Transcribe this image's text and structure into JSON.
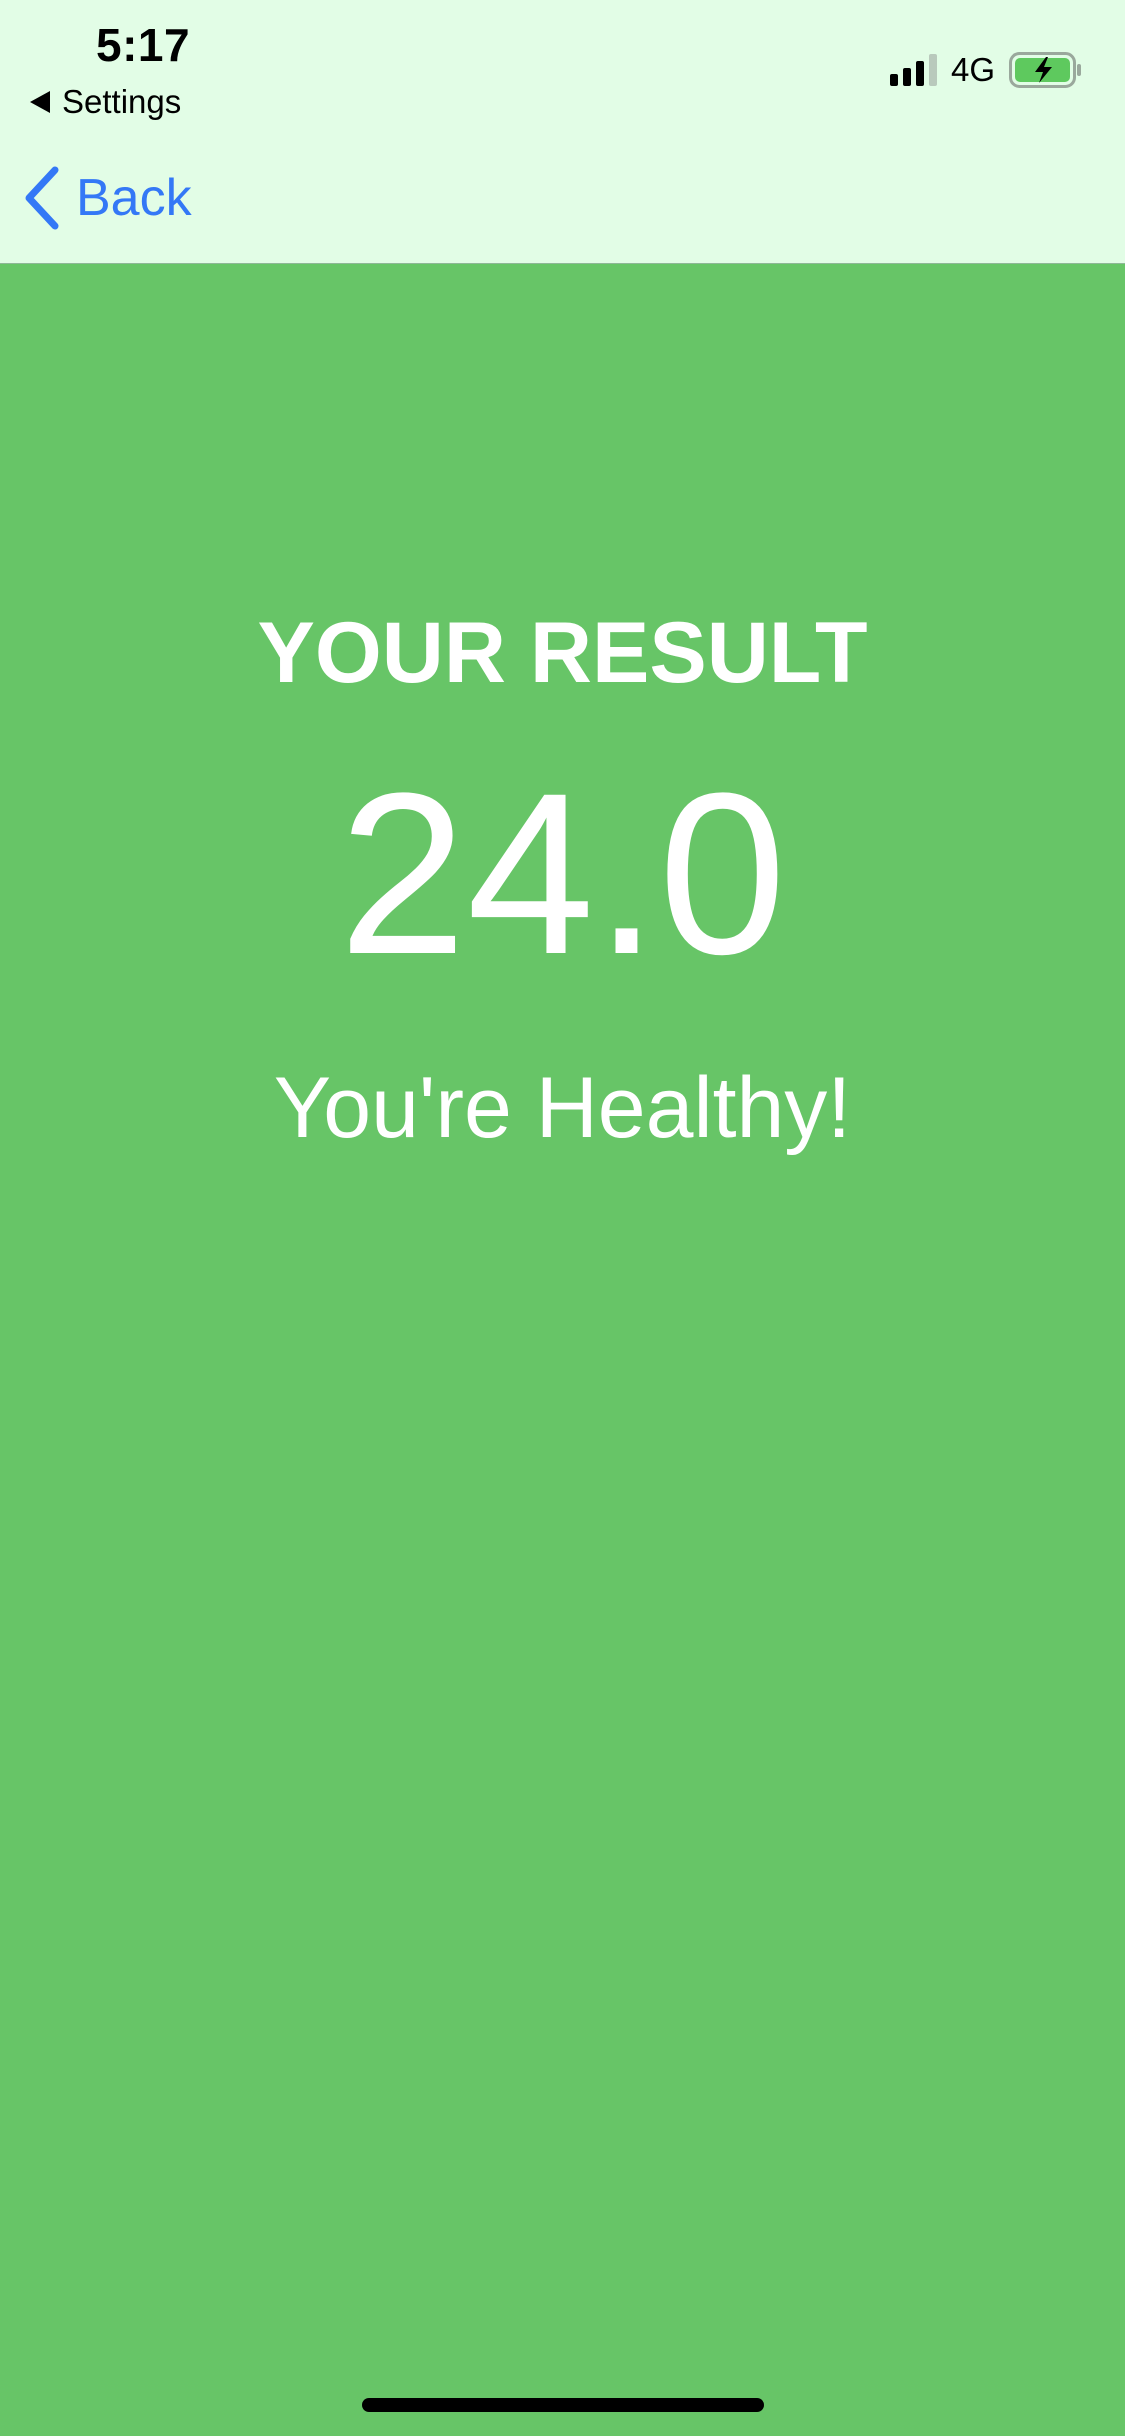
{
  "status_bar": {
    "time": "5:17",
    "back_to_app_label": "Settings",
    "network": "4G",
    "signal_bars_filled": 3,
    "signal_bars_total": 4,
    "battery_state": "charging"
  },
  "nav": {
    "back_label": "Back"
  },
  "result": {
    "title": "YOUR RESULT",
    "value": "24.0",
    "message": "You're Healthy!"
  },
  "colors": {
    "header_background": "#e2fde6",
    "result_background": "#67c567",
    "accent": "#3478f6",
    "text_on_result": "#ffffff"
  }
}
